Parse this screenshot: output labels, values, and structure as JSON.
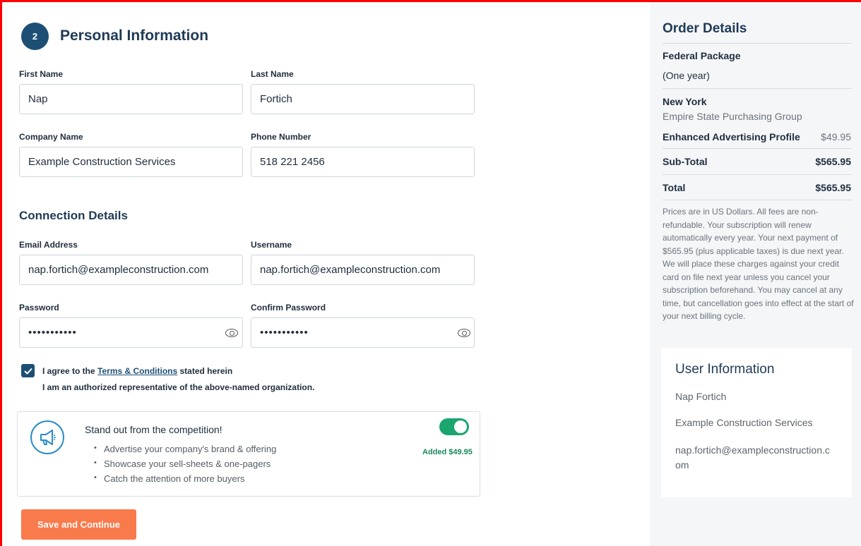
{
  "personal": {
    "step": "2",
    "title": "Personal Information",
    "first_name": {
      "label": "First Name",
      "value": "Nap"
    },
    "last_name": {
      "label": "Last Name",
      "value": "Fortich"
    },
    "company": {
      "label": "Company Name",
      "value": "Example Construction Services"
    },
    "phone": {
      "label": "Phone Number",
      "value": "518 221 2456"
    }
  },
  "connection": {
    "title": "Connection Details",
    "email": {
      "label": "Email Address",
      "value": "nap.fortich@exampleconstruction.com"
    },
    "username": {
      "label": "Username",
      "value": "nap.fortich@exampleconstruction.com"
    },
    "password": {
      "label": "Password",
      "value": "•••••••••••"
    },
    "confirm_password": {
      "label": "Confirm Password",
      "value": "•••••••••••"
    }
  },
  "agreement": {
    "prefix": "I agree to the ",
    "link": "Terms & Conditions",
    "suffix": " stated herein",
    "line2": "I am an authorized representative of the above-named organization."
  },
  "promo": {
    "title": "Stand out from the competition!",
    "bullets": [
      "Advertise your company's brand & offering",
      "Showcase your sell-sheets & one-pagers",
      "Catch the attention of more buyers"
    ],
    "added": "Added $49.95",
    "toggle_on": true
  },
  "save_label": "Save and Continue",
  "order": {
    "title": "Order Details",
    "package_line1": "Federal Package",
    "package_line2": "(One year)",
    "state": "New York",
    "group": "Empire State Purchasing Group",
    "addon_label": "Enhanced Advertising Profile",
    "addon_price": "$49.95",
    "subtotal_label": "Sub-Total",
    "subtotal_value": "$565.95",
    "total_label": "Total",
    "total_value": "$565.95",
    "disclaimer": "Prices are in US Dollars. All fees are non-refundable. Your subscription will renew automatically every year. Your next payment of $565.95 (plus applicable taxes) is due next year. We will place these charges against your credit card on file next year unless you cancel your subscription beforehand. You may cancel at any time, but cancellation goes into effect at the start of your next billing cycle."
  },
  "user_info": {
    "title": "User Information",
    "name": "Nap Fortich",
    "company": "Example Construction Services",
    "email": "nap.fortich@exampleconstruction.com"
  },
  "colors": {
    "primary": "#1d4f75",
    "accent": "#f97a4b",
    "success": "#1aa66e",
    "highlight_border": "#ff0000"
  }
}
